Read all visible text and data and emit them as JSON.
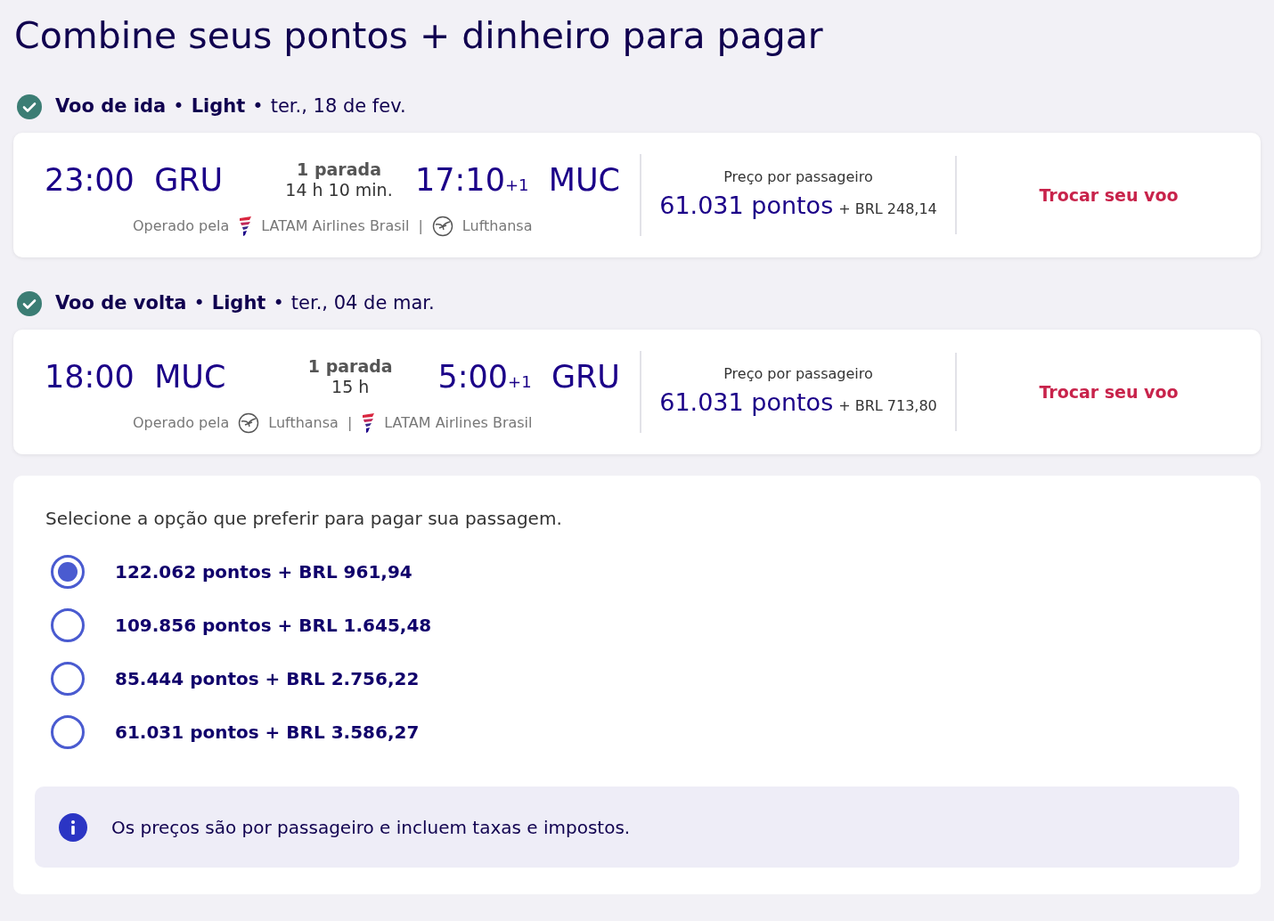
{
  "title": "Combine seus pontos + dinheiro para pagar",
  "legs": [
    {
      "label": "Voo de ida",
      "fare": "Light",
      "separator": "•",
      "date": "ter., 18 de fev.",
      "confirmed": true,
      "dep_time": "23:00",
      "dep_airport": "GRU",
      "stops": "1 parada",
      "duration": "14 h 10 min.",
      "arr_time": "17:10",
      "arr_offset": "+1",
      "arr_airport": "MUC",
      "operated_label": "Operado pela",
      "carrier_separator": "|",
      "carriers": [
        {
          "name": "LATAM Airlines Brasil",
          "kind": "latam"
        },
        {
          "name": "Lufthansa",
          "kind": "lufthansa"
        }
      ],
      "price_label": "Preço por passageiro",
      "points": "61.031 pontos",
      "cash": "+ BRL 248,14",
      "change_link": "Trocar seu voo"
    },
    {
      "label": "Voo de volta",
      "fare": "Light",
      "separator": "•",
      "date": "ter., 04 de mar.",
      "confirmed": true,
      "dep_time": "18:00",
      "dep_airport": "MUC",
      "stops": "1 parada",
      "duration": "15 h",
      "arr_time": "5:00",
      "arr_offset": "+1",
      "arr_airport": "GRU",
      "operated_label": "Operado pela",
      "carrier_separator": "|",
      "carriers": [
        {
          "name": "Lufthansa",
          "kind": "lufthansa"
        },
        {
          "name": "LATAM Airlines Brasil",
          "kind": "latam"
        }
      ],
      "price_label": "Preço por passageiro",
      "points": "61.031 pontos",
      "cash": "+ BRL 713,80",
      "change_link": "Trocar seu voo"
    }
  ],
  "payment": {
    "prompt": "Selecione a opção que preferir para pagar sua passagem.",
    "options": [
      {
        "label": "122.062 pontos + BRL 961,94",
        "selected": true
      },
      {
        "label": "109.856 pontos + BRL 1.645,48",
        "selected": false
      },
      {
        "label": "85.444 pontos + BRL 2.756,22",
        "selected": false
      },
      {
        "label": "61.031 pontos + BRL 3.586,27",
        "selected": false
      }
    ],
    "info": "Os preços são por passageiro e incluem taxas e impostos."
  }
}
